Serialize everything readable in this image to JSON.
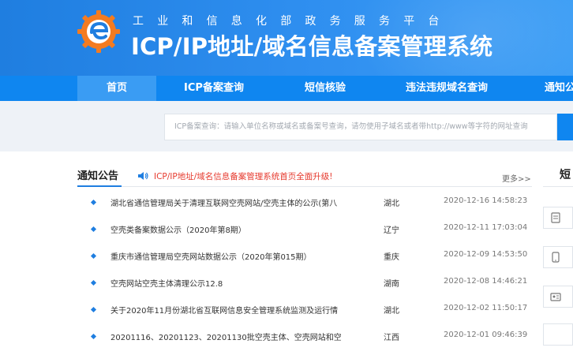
{
  "header": {
    "subtitle": "工业和信息化部政务服务平台",
    "title": "ICP/IP地址/域名信息备案管理系统"
  },
  "nav": {
    "items": [
      {
        "label": "首页",
        "active": true
      },
      {
        "label": "ICP备案查询",
        "active": false
      },
      {
        "label": "短信核验",
        "active": false
      },
      {
        "label": "违法违规域名查询",
        "active": false
      },
      {
        "label": "通知公",
        "active": false
      }
    ]
  },
  "search": {
    "placeholder": "ICP备案查询：请输入单位名称或域名或备案号查询，请勿使用子域名或者带http://www等字符的网址查询"
  },
  "notice": {
    "heading": "通知公告",
    "marquee": "ICP/IP地址/域名信息备案管理系统首页全面升级!",
    "more": "更多>>",
    "rows": [
      {
        "title": "湖北省通信管理局关于清理互联网空壳网站/空壳主体的公示(第八",
        "region": "湖北",
        "date": "2020-12-16 14:58:23"
      },
      {
        "title": "空壳类备案数据公示（2020年第8期）",
        "region": "辽宁",
        "date": "2020-12-11 17:03:04"
      },
      {
        "title": "重庆市通信管理局空壳网站数据公示（2020年第015期）",
        "region": "重庆",
        "date": "2020-12-09 14:53:50"
      },
      {
        "title": "空壳网站空壳主体清理公示12.8",
        "region": "湖南",
        "date": "2020-12-08 14:46:21"
      },
      {
        "title": "关于2020年11月份湖北省互联网信息安全管理系统监测及运行情",
        "region": "湖北",
        "date": "2020-12-02 11:50:17"
      },
      {
        "title": "20201116、20201123、20201130批空壳主体、空壳网站和空",
        "region": "江西",
        "date": "2020-12-01 09:46:39"
      }
    ]
  },
  "right_panel": {
    "heading": "短"
  },
  "colors": {
    "primary": "#0f86f0",
    "accent_red": "#e63a2e",
    "logo_orange": "#f47b20"
  }
}
